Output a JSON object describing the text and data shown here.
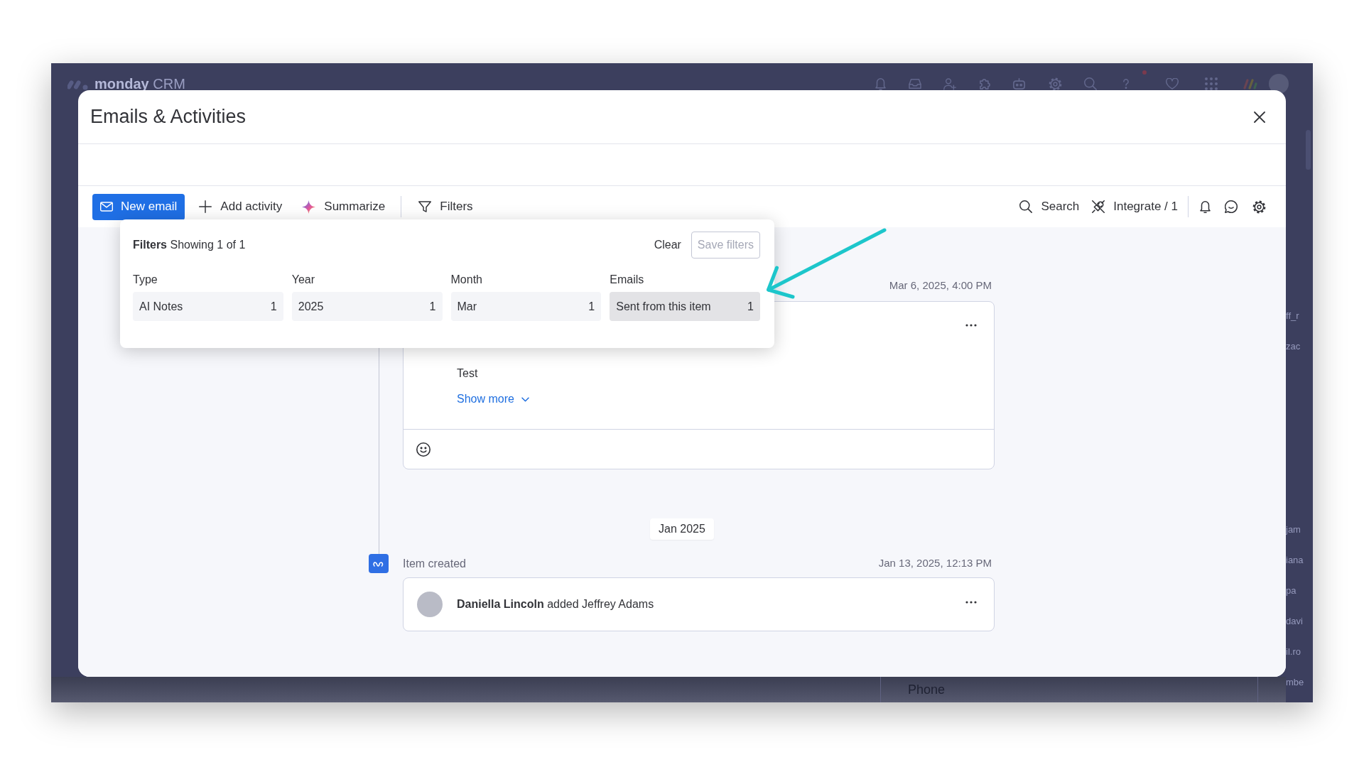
{
  "background_app": {
    "logo": "**monday** CRM",
    "table_cells_top": [
      "ff_r",
      "zac"
    ],
    "table_cells_bottom": [
      "jam",
      "iana",
      "pa",
      "davi",
      "il.ro",
      "mbe"
    ],
    "footer_cell": "Phone"
  },
  "modal": {
    "title": "Emails & Activities"
  },
  "toolbar": {
    "actions": [
      {
        "kind": "primary",
        "label": "New email"
      },
      {
        "kind": "text",
        "label": "Add activity"
      },
      {
        "kind": "text",
        "label": "Summarize"
      },
      {
        "kind": "text",
        "label": "Filters"
      }
    ],
    "tools": [
      {
        "label": "Search"
      },
      {
        "label": "Integrate / 1"
      }
    ]
  },
  "filters_popup": {
    "heading": "**Filters** Showing 1 of 1",
    "clear": "Clear",
    "save_button": {
      "label": "Save filters",
      "disabled": true
    },
    "groups": [
      {
        "label": "Type",
        "value": "AI Notes",
        "count": "1",
        "hovered": false
      },
      {
        "label": "Year",
        "value": "2025",
        "count": "1",
        "hovered": false
      },
      {
        "label": "Month",
        "value": "Mar",
        "count": "1",
        "hovered": false
      },
      {
        "label": "Emails",
        "value": "Sent from this item",
        "count": "1",
        "hovered": true
      }
    ]
  },
  "timeline": [
    {
      "kind": "activity",
      "timestamp": "Mar 6, 2025, 4:00 PM",
      "body": "Test",
      "link": "Show more"
    },
    {
      "kind": "month",
      "label": "Jan 2025"
    },
    {
      "kind": "event",
      "title": "Item created",
      "timestamp": "Jan 13, 2025, 12:13 PM",
      "text": "**Daniella Lincoln** added Jeffrey Adams"
    }
  ]
}
